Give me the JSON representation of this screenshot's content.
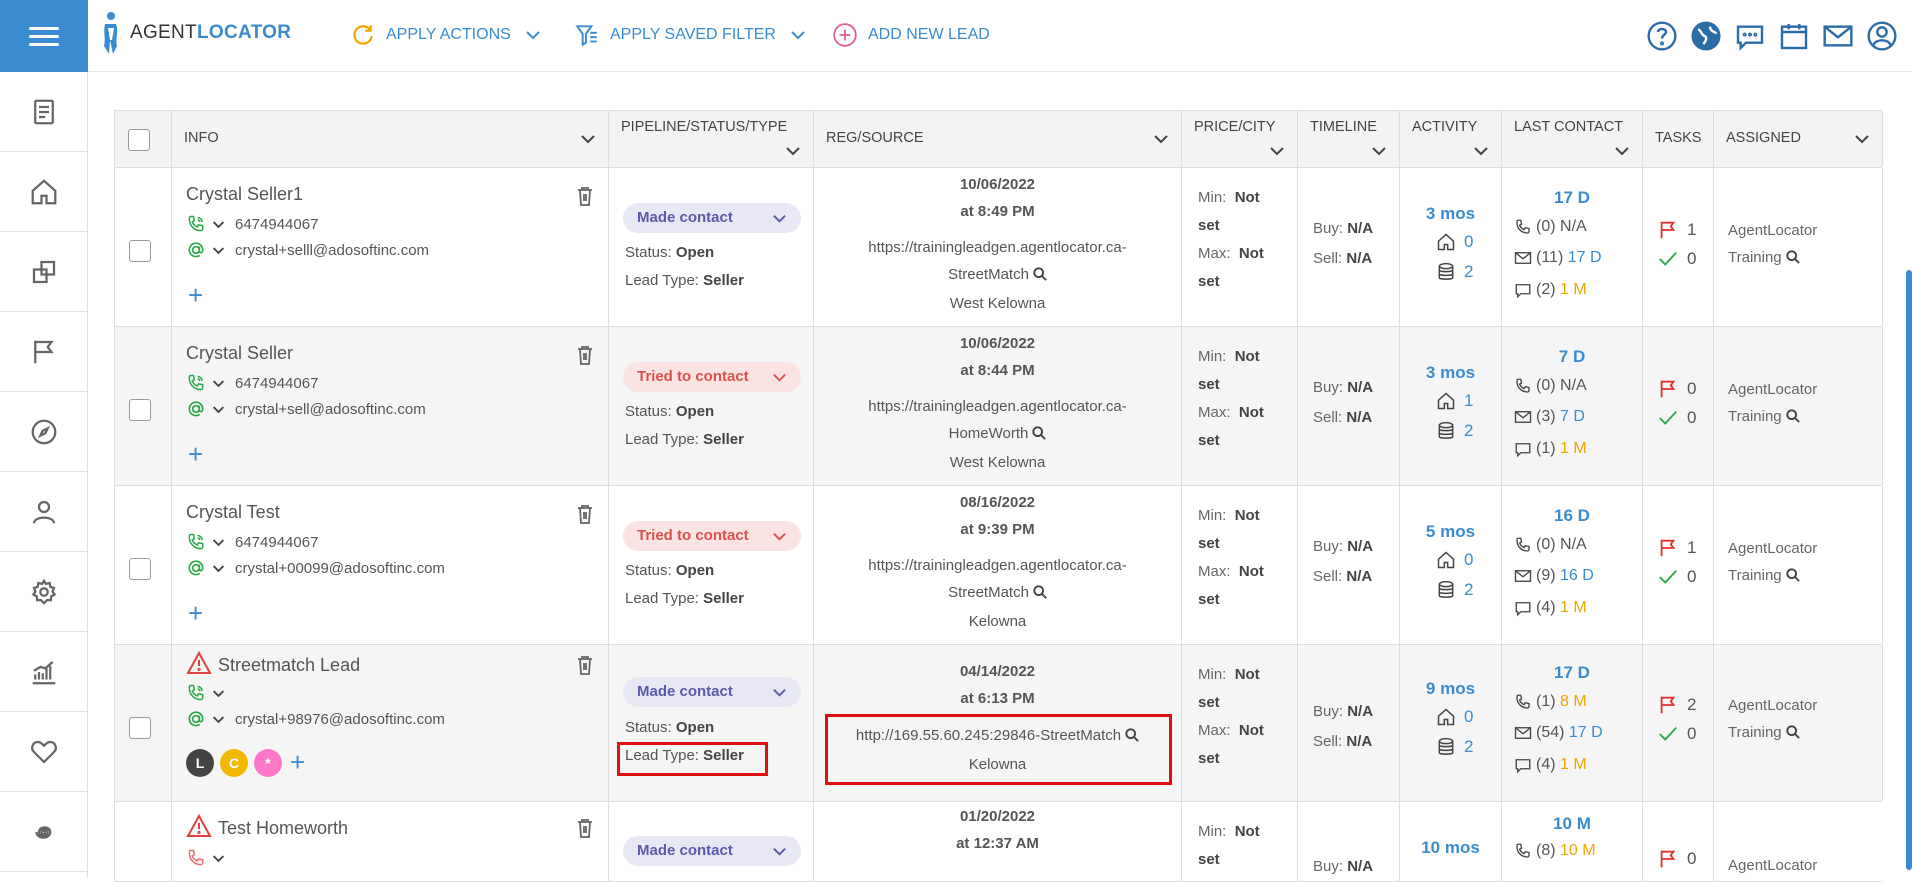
{
  "header": {
    "logo_a": "AGENT",
    "logo_b": "LOCATOR",
    "apply_actions": "APPLY ACTIONS",
    "apply_saved_filter": "APPLY SAVED FILTER",
    "add_new_lead": "ADD NEW LEAD"
  },
  "columns": {
    "info": "INFO",
    "pipeline": "PIPELINE/STATUS/TYPE",
    "reg": "REG/SOURCE",
    "price": "PRICE/CITY",
    "timeline": "TIMELINE",
    "activity": "ACTIVITY",
    "last_contact": "LAST CONTACT",
    "tasks": "TASKS",
    "assigned": "ASSIGNED"
  },
  "labels": {
    "status": "Status:",
    "lead_type": "Lead Type:",
    "min": "Min:",
    "max": "Max:",
    "buy": "Buy:",
    "sell": "Sell:",
    "not_set": "Not",
    "set": "set",
    "na": "N/A"
  },
  "rows": [
    {
      "name": "Crystal Seller1",
      "phone": "6474944067",
      "email": "crystal+selll@adosoftinc.com",
      "pipeline": "Made contact",
      "status": "Open",
      "lead_type": "Seller",
      "reg_date": "10/06/2022",
      "reg_time": "at 8:49 PM",
      "source_line1": "https://trainingleadgen.agentlocator.ca-",
      "source_line2": "StreetMatch",
      "city": "West Kelowna",
      "buy": "N/A",
      "sell": "N/A",
      "activity_time": "3 mos",
      "activity_homes": "0",
      "activity_db": "2",
      "lc_top": "17 D",
      "lc_calls": "(0)",
      "lc_calls_val": "N/A",
      "lc_emails": "(11)",
      "lc_emails_val": "17 D",
      "lc_msgs": "(2)",
      "lc_msgs_val": "1 M",
      "tasks_flag": "1",
      "tasks_check": "0",
      "assigned1": "AgentLocator",
      "assigned2": "Training"
    },
    {
      "name": "Crystal Seller",
      "phone": "6474944067",
      "email": "crystal+sell@adosoftinc.com",
      "pipeline": "Tried to contact",
      "status": "Open",
      "lead_type": "Seller",
      "reg_date": "10/06/2022",
      "reg_time": "at 8:44 PM",
      "source_line1": "https://trainingleadgen.agentlocator.ca-",
      "source_line2": "HomeWorth",
      "city": "West Kelowna",
      "buy": "N/A",
      "sell": "N/A",
      "activity_time": "3 mos",
      "activity_homes": "1",
      "activity_db": "2",
      "lc_top": "7 D",
      "lc_calls": "(0)",
      "lc_calls_val": "N/A",
      "lc_emails": "(3)",
      "lc_emails_val": "7 D",
      "lc_msgs": "(1)",
      "lc_msgs_val": "1 M",
      "tasks_flag": "0",
      "tasks_check": "0",
      "assigned1": "AgentLocator",
      "assigned2": "Training"
    },
    {
      "name": "Crystal Test",
      "phone": "6474944067",
      "email": "crystal+00099@adosoftinc.com",
      "pipeline": "Tried to contact",
      "status": "Open",
      "lead_type": "Seller",
      "reg_date": "08/16/2022",
      "reg_time": "at 9:39 PM",
      "source_line1": "https://trainingleadgen.agentlocator.ca-",
      "source_line2": "StreetMatch",
      "city": "Kelowna",
      "buy": "N/A",
      "sell": "N/A",
      "activity_time": "5 mos",
      "activity_homes": "0",
      "activity_db": "2",
      "lc_top": "16 D",
      "lc_calls": "(0)",
      "lc_calls_val": "N/A",
      "lc_emails": "(9)",
      "lc_emails_val": "16 D",
      "lc_msgs": "(4)",
      "lc_msgs_val": "1 M",
      "tasks_flag": "1",
      "tasks_check": "0",
      "assigned1": "AgentLocator",
      "assigned2": "Training"
    },
    {
      "name": "Streetmatch Lead",
      "email": "crystal+98976@adosoftinc.com",
      "badges": [
        "L",
        "C",
        "*"
      ],
      "pipeline": "Made contact",
      "status": "Open",
      "lead_type": "Seller",
      "reg_date": "04/14/2022",
      "reg_time": "at 6:13 PM",
      "source_line1": "http://169.55.60.245:29846-StreetMatch",
      "city": "Kelowna",
      "buy": "N/A",
      "sell": "N/A",
      "activity_time": "9 mos",
      "activity_homes": "0",
      "activity_db": "2",
      "lc_top": "17 D",
      "lc_calls": "(1)",
      "lc_calls_val": "8 M",
      "lc_emails": "(54)",
      "lc_emails_val": "17 D",
      "lc_msgs": "(4)",
      "lc_msgs_val": "1 M",
      "tasks_flag": "2",
      "tasks_check": "0",
      "assigned1": "AgentLocator",
      "assigned2": "Training"
    },
    {
      "name": "Test Homeworth",
      "pipeline": "Made contact",
      "reg_date": "01/20/2022",
      "reg_time": "at 12:37 AM",
      "buy": "N/A",
      "activity_time": "10 mos",
      "lc_top": "10 M",
      "lc_calls": "(8)",
      "lc_calls_val": "10 M",
      "tasks_flag": "0",
      "assigned1": "AgentLocator"
    }
  ]
}
